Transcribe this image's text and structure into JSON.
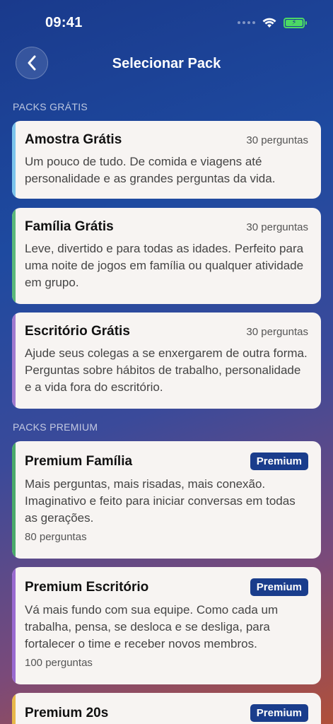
{
  "status": {
    "time": "09:41"
  },
  "nav": {
    "title": "Selecionar Pack"
  },
  "sections": {
    "free": "PACKS GRÁTIS",
    "premium": "PACKS PREMIUM"
  },
  "free_packs": [
    {
      "title": "Amostra Grátis",
      "count": "30 perguntas",
      "desc": "Um pouco de tudo. De comida e viagens até personalidade e as grandes perguntas da vida.",
      "accent": "#7cc4ec"
    },
    {
      "title": "Família Grátis",
      "count": "30 perguntas",
      "desc": "Leve, divertido e para todas as idades. Perfeito para uma noite de jogos em família ou qualquer atividade em grupo.",
      "accent": "#5ab87a"
    },
    {
      "title": "Escritório Grátis",
      "count": "30 perguntas",
      "desc": "Ajude seus colegas a se enxergarem de outra forma. Perguntas sobre hábitos de trabalho, personalidade e a vida fora do escritório.",
      "accent": "#a07ad0"
    }
  ],
  "premium_packs": [
    {
      "title": "Premium Família",
      "badge": "Premium",
      "desc": "Mais perguntas, mais risadas, mais conexão. Imaginativo e feito para iniciar conversas em todas as gerações.",
      "count": "80 perguntas",
      "accent": "#4aaa6a"
    },
    {
      "title": "Premium Escritório",
      "badge": "Premium",
      "desc": "Vá mais fundo com sua equipe. Como cada um trabalha, pensa, se desloca e se desliga, para fortalecer o time e receber novos membros.",
      "count": "100 perguntas",
      "accent": "#9a6ad0"
    },
    {
      "title": "Premium 20s",
      "badge": "Premium",
      "accent": "#e8b84a"
    }
  ]
}
